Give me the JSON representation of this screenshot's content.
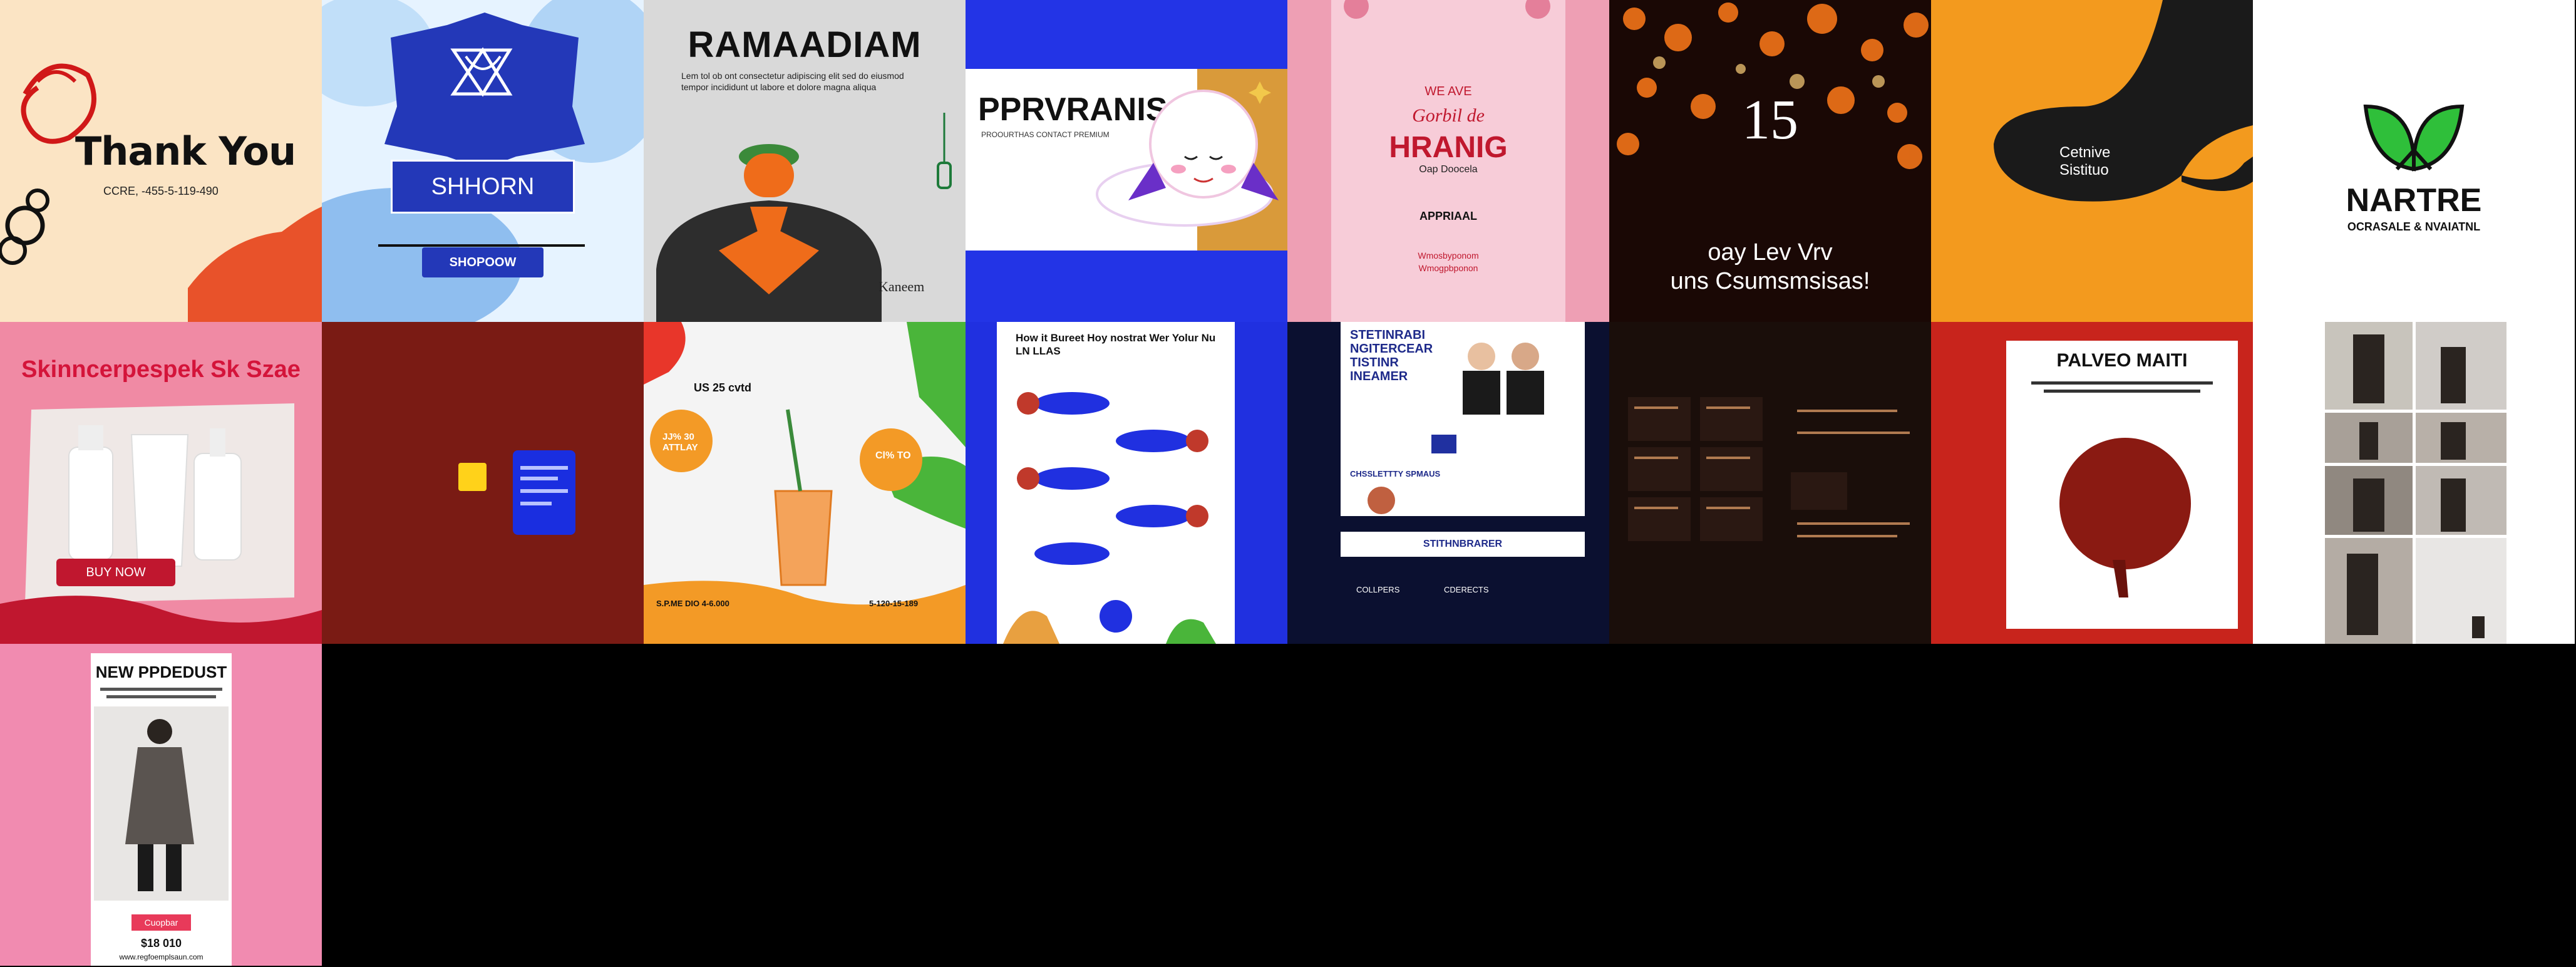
{
  "tiles": {
    "thank_you": {
      "title": "Thank You",
      "sub": "CCRE, -455-5-119-490",
      "colors": {
        "bg": "#fbe4c4",
        "accent": "#e8522a"
      }
    },
    "shhorn": {
      "banner": "SHHORN",
      "button": "SHOPOOW",
      "colors": {
        "bg": "#dff0ff",
        "brand": "#2338b8"
      }
    },
    "ramadan": {
      "title": "RAMAADIAM",
      "body": "Lem tol ob ont consectetur adipiscing elit sed do eiusmod tempor incididunt ut labore et dolore magna aliqua",
      "signature": "Kaneem",
      "colors": {
        "bg": "#d9d9d9",
        "robe": "#2d2d2d",
        "hands": "#ef6c1a"
      }
    },
    "pprvranis": {
      "title": "PPRVRANIS",
      "sub": "PROOURTHAS CONTACT PREMIUM",
      "colors": {
        "bg": "#2334e6",
        "card": "#ffffff",
        "accent": "#d99a3a"
      }
    },
    "wedding": {
      "top": "WE AVE",
      "script": "Gorbil de",
      "name": "HRANIG",
      "sub": "Oap Doocela",
      "approval": "APPRIAAL",
      "contact": "Wmosbyponom",
      "web": "Wmogpbponon",
      "colors": {
        "bg": "#f3b6c7",
        "text": "#c0182e"
      }
    },
    "bokeh": {
      "number": "15",
      "line1": "oay Lev Vrv",
      "line2": "uns Csumsmsisas!",
      "colors": {
        "bg": "#1a0805"
      }
    },
    "creative": {
      "line1": "Cetnive",
      "line2": "Sistituo",
      "colors": {
        "bg": "#f39a1e",
        "blob": "#1a1a1a"
      }
    },
    "nartre": {
      "title": "NARTRE",
      "sub": "OCRASALE & NVAIATNL",
      "colors": {
        "bg": "#ffffff",
        "leaf": "#2fbf3a"
      }
    },
    "skincare": {
      "title": "Skinncerpespek Sk Szae",
      "button": "BUY NOW",
      "colors": {
        "bg": "#f08aa4",
        "title": "#d4143a",
        "button": "#c0172f"
      }
    },
    "maroon_card": {
      "colors": {
        "bg": "#7a1b14",
        "card": "#1a2ee0",
        "chip": "#ffd21a"
      }
    },
    "juice": {
      "promo": "US 25 cvtd",
      "tag1": "JJ% 30 ATTLAY",
      "tag2": "Cl% TO",
      "footer_left": "S.P.ME DIO 4-6.000",
      "footer_right": "5-120-15-189",
      "colors": {
        "bg": "#f4f4f4",
        "orange": "#f39a26",
        "green": "#4ab53a"
      }
    },
    "infographic": {
      "title": "How it Bureet Hoy nostrat Wer Yolur Nu LN LLAS",
      "colors": {
        "bg": "#2030e0",
        "card": "#ffffff"
      }
    },
    "webinar": {
      "title": "STETINRABI NGITERCEAR TISTINR INEAMER",
      "bio": "CHSSLETTTY SPMAUS",
      "bar": "STITHNBRARER",
      "contact1": "COLLPERS",
      "contact2": "CDERECTS",
      "colors": {
        "bg": "#0b1030",
        "card": "#ffffff",
        "text": "#1e2a8a"
      }
    },
    "dark_grid": {
      "colors": {
        "bg": "#1a0e0a",
        "text": "#b07a50"
      }
    },
    "palveo": {
      "title": "PALVEO MAITI",
      "colors": {
        "bg": "#c8241c",
        "card": "#ffffff",
        "ball": "#8a1a12"
      }
    },
    "collage": {
      "colors": {
        "bg": "#ffffff"
      }
    },
    "new_product": {
      "title": "NEW PPDEDUST",
      "badge": "Cuopbar",
      "price": "$18 010",
      "web": "www.regfoemplsaun.com",
      "colors": {
        "bg": "#f18bb0",
        "badge": "#e83a5a"
      }
    }
  }
}
